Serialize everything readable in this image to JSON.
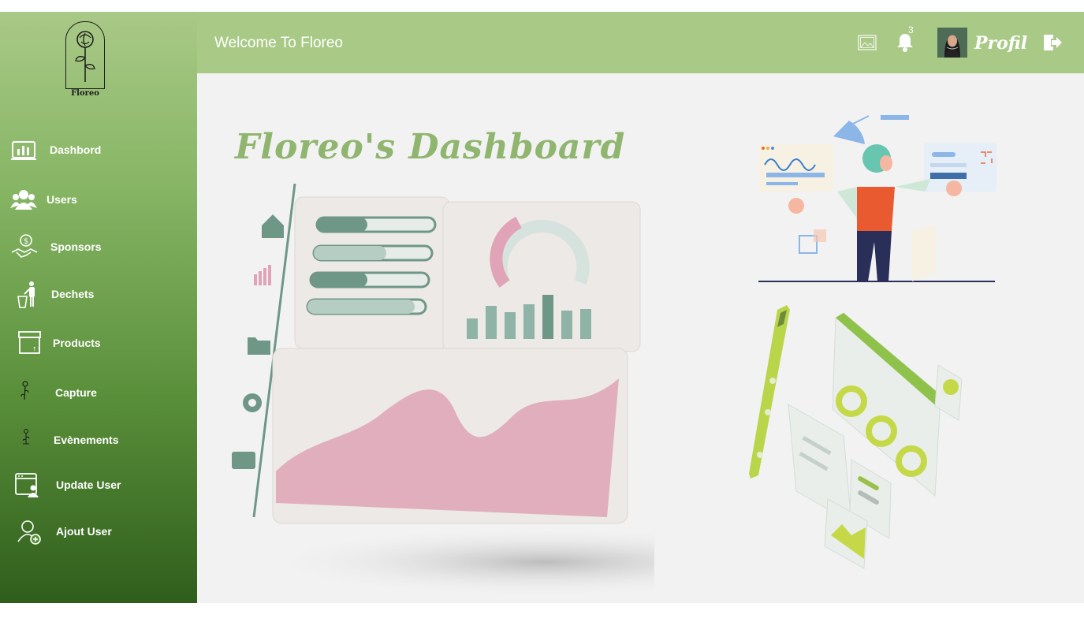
{
  "app": {
    "name": "Floreo"
  },
  "logo": {
    "text": "Floreo"
  },
  "sidebar": {
    "items": [
      {
        "label": "Dashbord",
        "icon": "chart-bars-icon"
      },
      {
        "label": "Users",
        "icon": "users-icon"
      },
      {
        "label": "Sponsors",
        "icon": "handshake-dollar-icon"
      },
      {
        "label": "Dechets",
        "icon": "trash-person-icon"
      },
      {
        "label": "Products",
        "icon": "box-icon"
      },
      {
        "label": "Capture",
        "icon": "flower-sketch-icon"
      },
      {
        "label": "Evènements",
        "icon": "flower-small-icon"
      },
      {
        "label": "Update User",
        "icon": "window-user-icon"
      },
      {
        "label": "Ajout User",
        "icon": "add-user-icon"
      }
    ]
  },
  "header": {
    "welcome": "Welcome To Floreo",
    "notifications_count": "3",
    "profile_label": "Profil"
  },
  "main": {
    "title": "Floreo's Dashboard"
  },
  "colors": {
    "topbar": "#a9c987",
    "sidebar_top": "#a9c987",
    "sidebar_bottom": "#2f5e1c",
    "title": "#8fb56f",
    "background": "#f2f2f2"
  }
}
